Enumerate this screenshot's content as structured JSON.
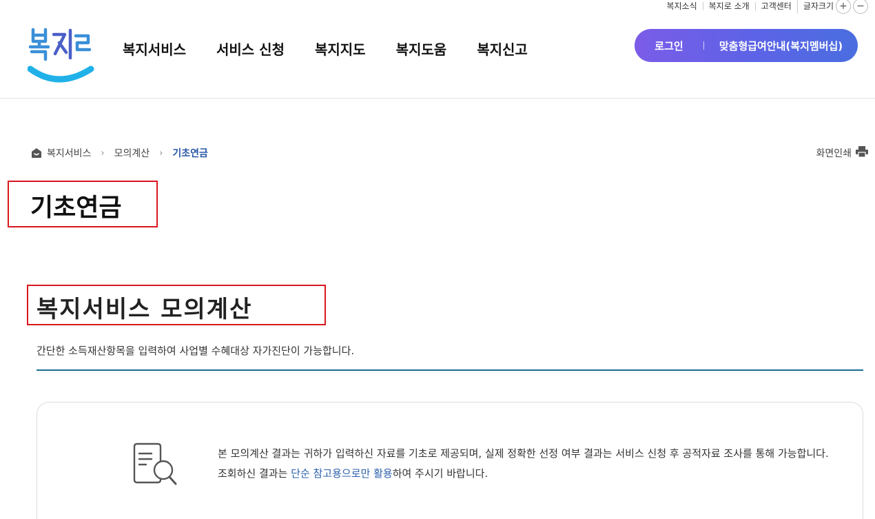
{
  "utility": {
    "links": [
      "복지소식",
      "복지로 소개",
      "고객센터"
    ],
    "font_size_label": "글자크기",
    "plus": "+",
    "minus": "−"
  },
  "header": {
    "logo_text": "복지로",
    "nav": [
      "복지서비스",
      "서비스 신청",
      "복지지도",
      "복지도움",
      "복지신고"
    ],
    "login_label": "로그인",
    "membership_label": "맞춤형급여안내(복지멤버십)"
  },
  "breadcrumb": {
    "items": [
      "복지서비스",
      "모의계산",
      "기초연금"
    ]
  },
  "print_label": "화면인쇄",
  "page_title": "기초연금",
  "section": {
    "title": "복지서비스 모의계산",
    "description": "간단한 소득재산항목을 입력하여 사업별 수혜대상 자가진단이 가능합니다."
  },
  "notice": {
    "text_part1": "본 모의계산 결과는 귀하가 입력하신 자료를 기초로 제공되며, 실제 정확한 선정 여부 결과는 서비스 신청 후 공적자료 조사를 통해 가능합니다. 조회하신 결과는 ",
    "highlight": "단순 참고용으로만 활용",
    "text_part2": "하여 주시기 바랍니다."
  },
  "colors": {
    "brand_blue": "#2857a6",
    "pill_start": "#7b5ce8",
    "pill_end": "#4a6ee0",
    "divider": "#1a6c98",
    "highlight_box": "#d9161d"
  }
}
